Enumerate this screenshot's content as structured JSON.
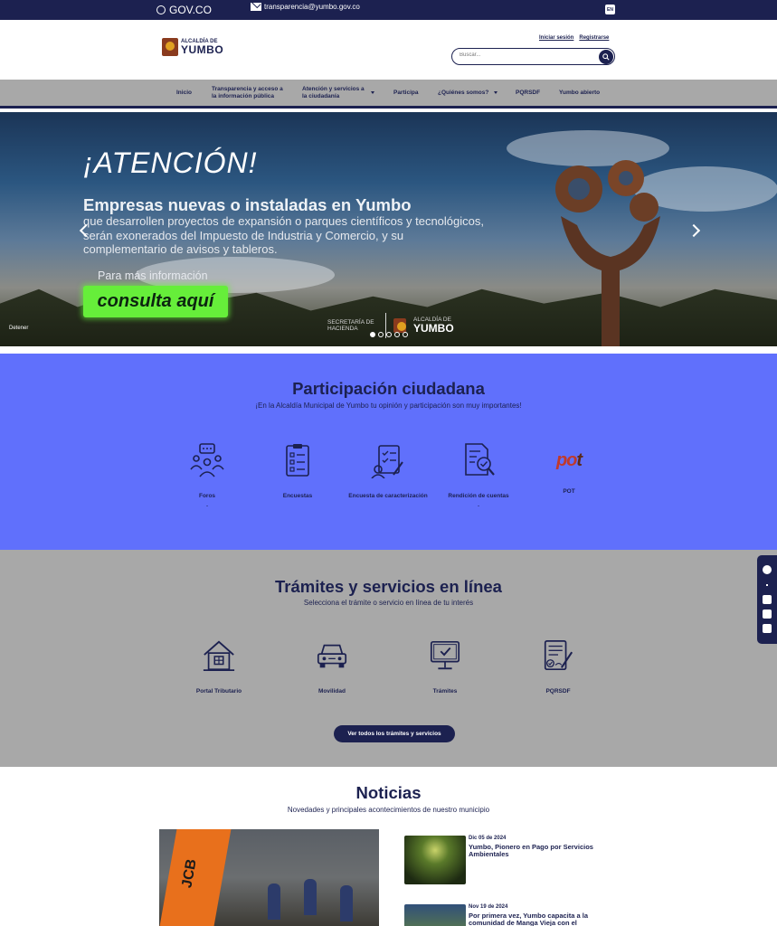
{
  "gov_bar": {
    "gov_label": "GOV.CO",
    "email": "transparencia@yumbo.gov.co",
    "lang": "EN"
  },
  "header": {
    "logo_small": "ALCALDÍA DE",
    "logo_big": "YUMBO",
    "login": "Iniciar sesión",
    "register": "Registrarse",
    "search_placeholder": "Buscar..."
  },
  "nav": {
    "items": [
      {
        "label": "Inicio"
      },
      {
        "label": "Transparencia y acceso a la información pública"
      },
      {
        "label": "Atención y servicios a la ciudadanía"
      },
      {
        "label": "Participa"
      },
      {
        "label": "¿Quiénes somos?"
      },
      {
        "label": "PQRSDF"
      },
      {
        "label": "Yumbo abierto"
      }
    ]
  },
  "hero": {
    "heading": "¡ATENCIÓN!",
    "subheading": "Empresas nuevas o instaladas en Yumbo",
    "body": "que desarrollen proyectos de expansión o parques científicos y tecnológicos, serán exonerados del Impuesto de Industria y Comercio, y su complementario de avisos y tableros.",
    "more": "Para más información",
    "cta": "consulta aquí",
    "sponsor_left": "SECRETARÍA DE HACIENDA",
    "sponsor_small": "ALCALDÍA DE",
    "sponsor_big": "YUMBO",
    "stop": "Detener",
    "slide_count": 5,
    "active_slide": 1
  },
  "participation": {
    "title": "Participación ciudadana",
    "subtitle": "¡En la Alcaldía Municipal de Yumbo tu opinión y participación son muy importantes!",
    "items": [
      {
        "label": "Foros",
        "note": "."
      },
      {
        "label": "Encuestas",
        "note": ""
      },
      {
        "label": "Encuesta de caracterización",
        "note": ""
      },
      {
        "label": "Rendición de cuentas",
        "note": "."
      },
      {
        "label": "POT",
        "note": ""
      }
    ],
    "pot_logo_a": "po",
    "pot_logo_b": "t"
  },
  "tramites": {
    "title": "Trámites y servicios en línea",
    "subtitle": "Selecciona el trámite o servicio en línea de tu interés",
    "items": [
      {
        "label": "Portal Tributario"
      },
      {
        "label": "Movilidad"
      },
      {
        "label": "Trámites"
      },
      {
        "label": "PQRSDF"
      }
    ],
    "see_all": "Ver todos los trámites y servicios"
  },
  "news": {
    "title": "Noticias",
    "subtitle": "Novedades y principales acontecimientos de nuestro municipio",
    "feature_brand": "JCB",
    "items": [
      {
        "date": "Dic 05 de 2024",
        "title": "Yumbo, Pionero en Pago por Servicios Ambientales"
      },
      {
        "date": "Nov 19 de 2024",
        "title": "Por primera vez, Yumbo capacita a la comunidad de Manga Vieja con el"
      }
    ]
  },
  "colors": {
    "navy": "#1c2150",
    "participation_bg": "#6070fc",
    "gray_bg": "#a8a8a8",
    "cta_green": "#66ee3a"
  }
}
